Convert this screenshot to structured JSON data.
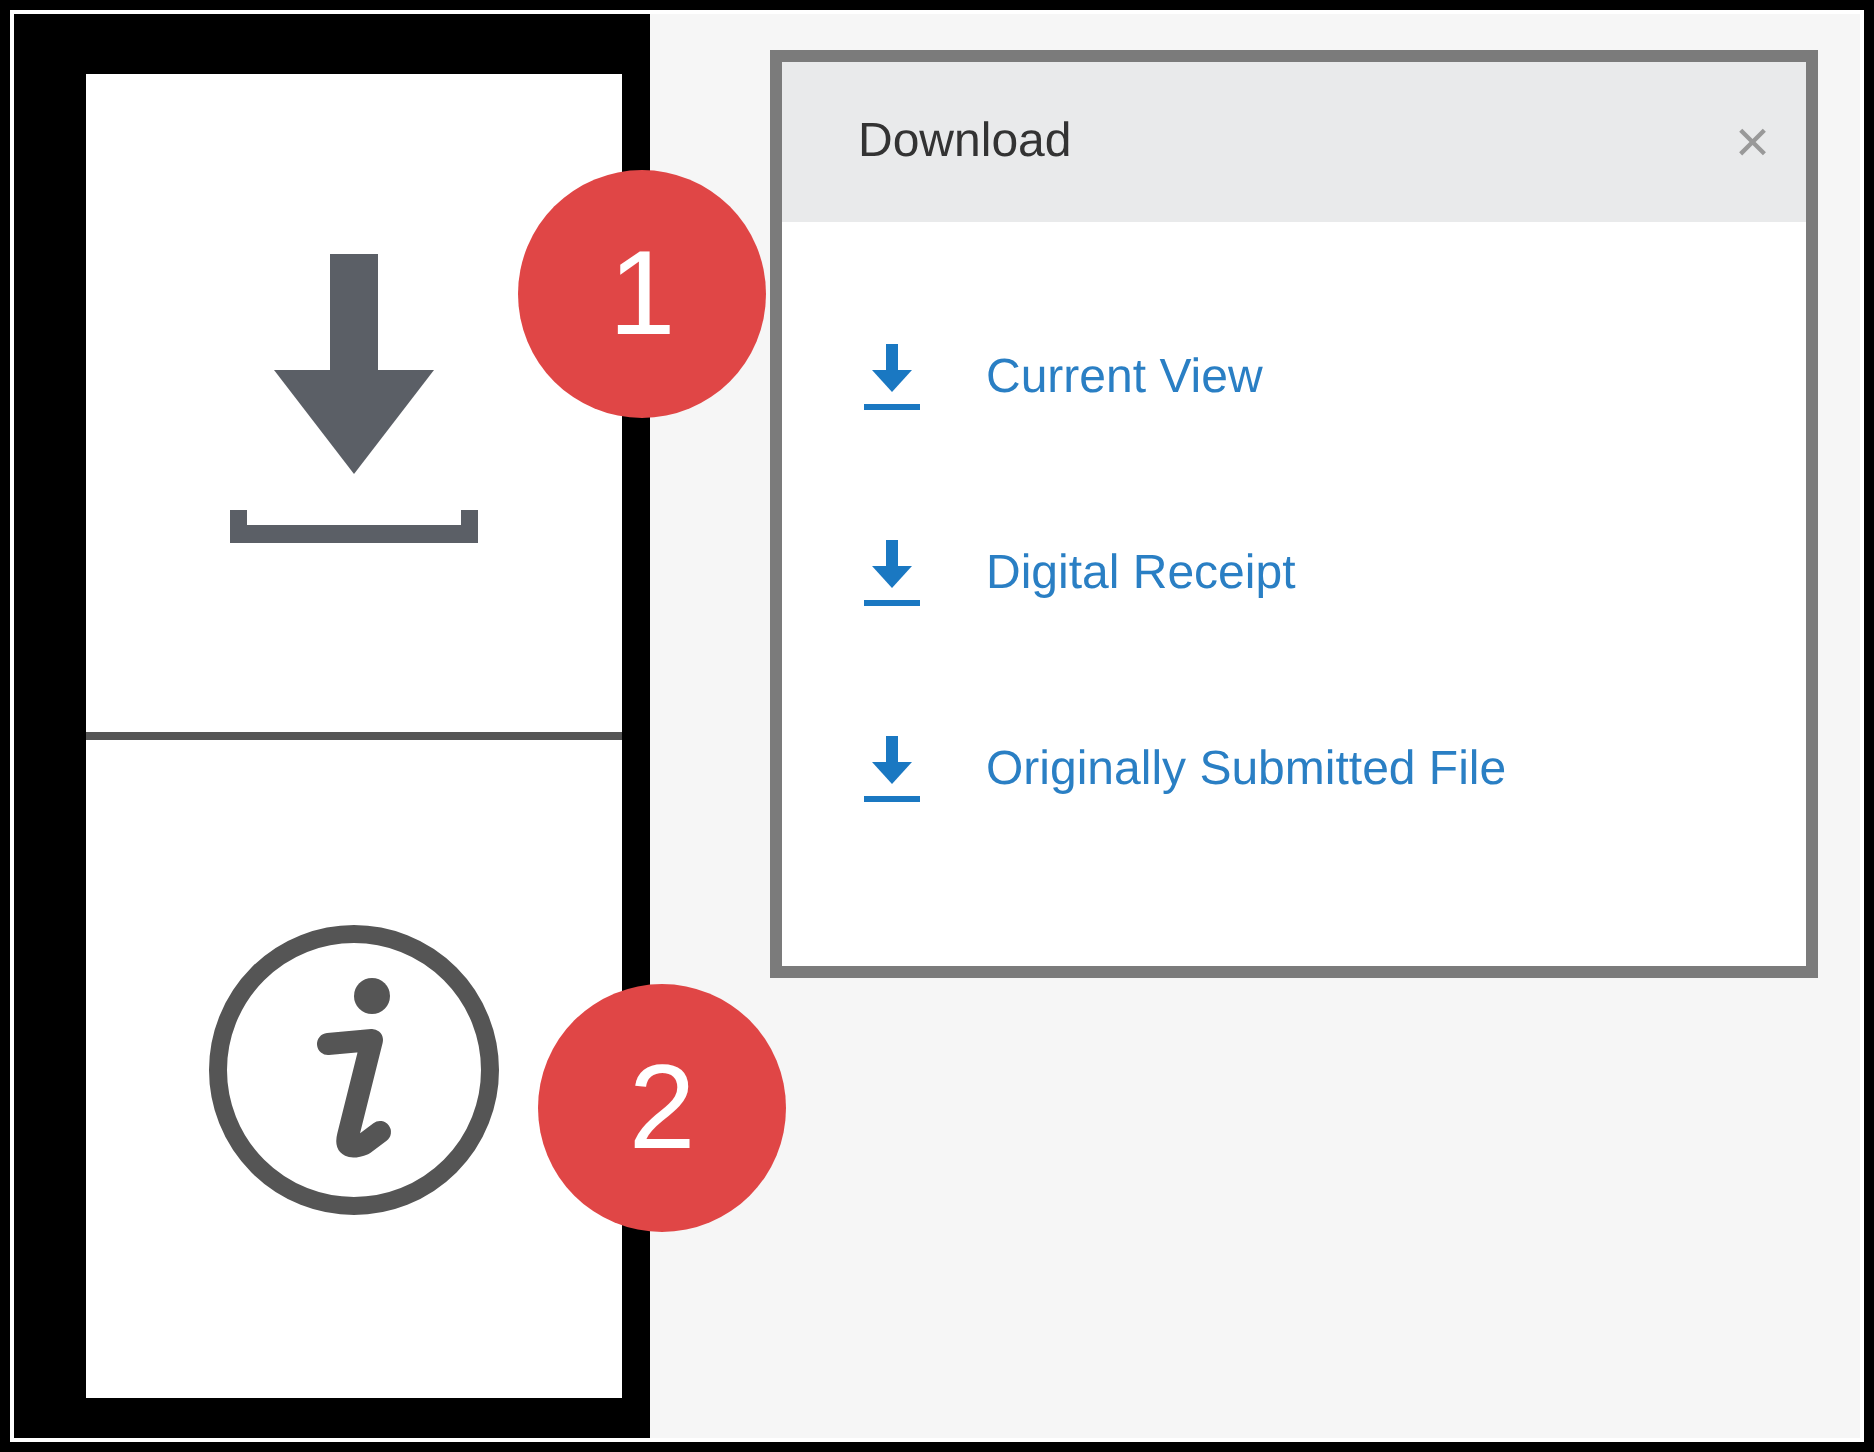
{
  "sidebar": {
    "items": [
      {
        "kind": "download"
      },
      {
        "kind": "info"
      }
    ]
  },
  "panel": {
    "title": "Download",
    "close": "×",
    "items": [
      {
        "label": "Current View"
      },
      {
        "label": "Digital Receipt"
      },
      {
        "label": "Originally Submitted File"
      }
    ]
  },
  "callouts": [
    {
      "label": "1"
    },
    {
      "label": "2"
    }
  ]
}
